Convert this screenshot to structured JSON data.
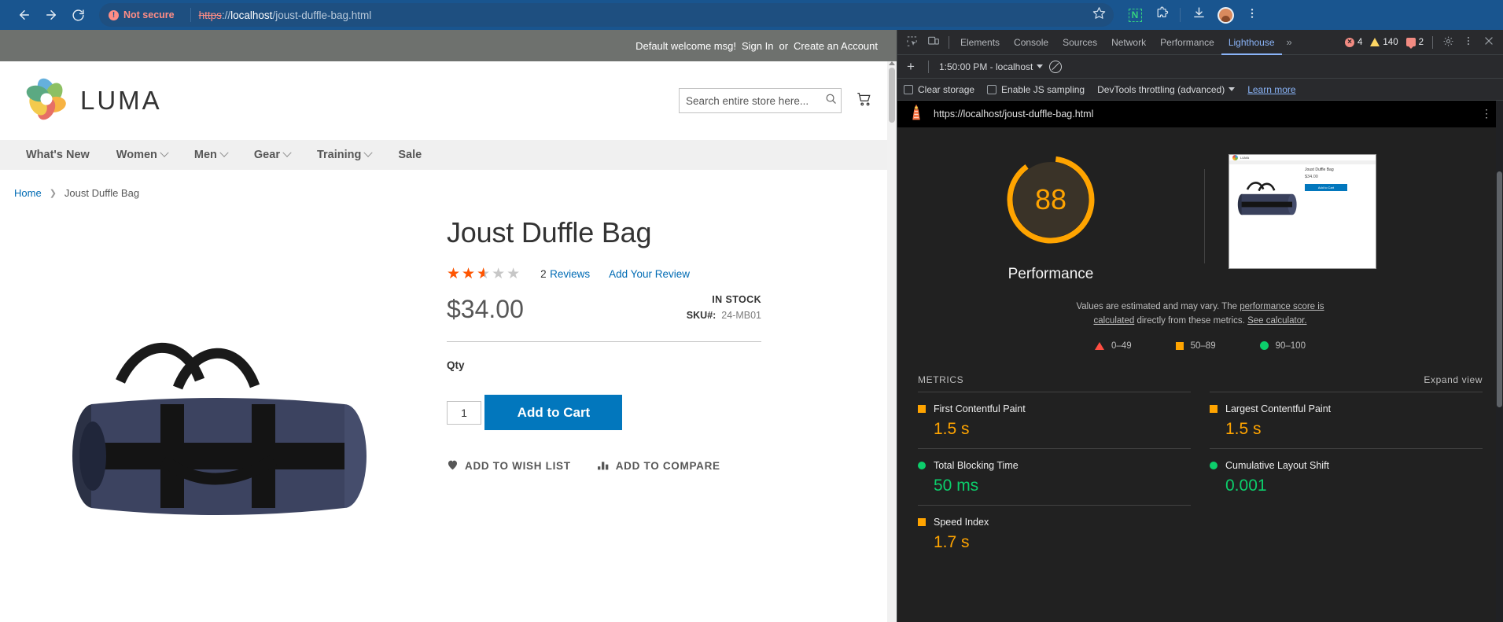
{
  "browser": {
    "back_icon": "back-arrow-icon",
    "forward_icon": "forward-arrow-icon",
    "reload_icon": "reload-icon",
    "security_label": "Not secure",
    "url_scheme": "https",
    "url_sep": "://",
    "url_host": "localhost",
    "url_path": "/joust-duffle-bag.html",
    "bookmark_icon": "star-icon",
    "extension_badge": "N",
    "extensions_icon": "puzzle-piece-icon",
    "downloads_icon": "download-icon",
    "profile_icon": "avatar-icon",
    "menu_icon": "three-dot-menu-icon"
  },
  "store": {
    "topbar": {
      "welcome": "Default welcome msg!",
      "sign_in": "Sign In",
      "or": "or",
      "create_account": "Create an Account"
    },
    "brand": "LUMA",
    "search": {
      "placeholder": "Search entire store here...",
      "value": "",
      "icon": "search-icon"
    },
    "cart_icon": "shopping-cart-icon",
    "nav": [
      {
        "label": "What's New",
        "has_chevron": false
      },
      {
        "label": "Women",
        "has_chevron": true
      },
      {
        "label": "Men",
        "has_chevron": true
      },
      {
        "label": "Gear",
        "has_chevron": true
      },
      {
        "label": "Training",
        "has_chevron": true
      },
      {
        "label": "Sale",
        "has_chevron": false
      }
    ],
    "breadcrumb": {
      "home": "Home",
      "separator": "❯",
      "current": "Joust Duffle Bag"
    },
    "product": {
      "title": "Joust Duffle Bag",
      "rating_percent": "50%",
      "stars_bg": "★★★★★",
      "review_count": "2",
      "reviews_label": "Reviews",
      "add_review": "Add Your Review",
      "price": "$34.00",
      "availability": "IN STOCK",
      "sku_label": "SKU#:",
      "sku_value": "24-MB01",
      "qty_label": "Qty",
      "qty_value": "1",
      "add_to_cart": "Add to Cart",
      "wish_list": "ADD TO WISH LIST",
      "wish_list_icon": "heart-icon",
      "compare": "ADD TO COMPARE",
      "compare_icon": "bar-chart-icon"
    }
  },
  "devtools": {
    "inspect_icon": "inspect-element-icon",
    "device_icon": "device-toolbar-icon",
    "tabs": [
      {
        "label": "Elements",
        "active": false
      },
      {
        "label": "Console",
        "active": false
      },
      {
        "label": "Sources",
        "active": false
      },
      {
        "label": "Network",
        "active": false
      },
      {
        "label": "Performance",
        "active": false
      },
      {
        "label": "Lighthouse",
        "active": true
      }
    ],
    "more_tabs": "»",
    "errors": "4",
    "warnings": "140",
    "violations": "2",
    "settings_icon": "gear-icon",
    "kebab_icon": "three-dot-menu-icon",
    "close_icon": "close-icon",
    "lighthouse_toolbar": {
      "new_report_icon": "plus-icon",
      "run_selector": "1:50:00 PM - localhost",
      "clear_icon": "clear-icon"
    },
    "lighthouse_settings": {
      "clear_storage": "Clear storage",
      "enable_js_sampling": "Enable JS sampling",
      "throttling": "DevTools throttling (advanced)",
      "learn_more": "Learn more"
    },
    "report": {
      "lighthouse_icon": "lighthouse-icon",
      "url": "https://localhost/joust-duffle-bag.html",
      "kebab_icon": "three-dot-menu-icon",
      "score": "88",
      "category": "Performance",
      "description_part1": "Values are estimated and may vary. The ",
      "description_link1": "performance score is calculated",
      "description_part2": " directly from these metrics. ",
      "description_link2": "See calculator.",
      "legend": [
        {
          "shape": "triangle",
          "range": "0–49",
          "color": "#ff4e42"
        },
        {
          "shape": "square",
          "range": "50–89",
          "color": "#ffa400"
        },
        {
          "shape": "circle",
          "range": "90–100",
          "color": "#0cce6b"
        }
      ],
      "metrics_heading": "METRICS",
      "expand_view": "Expand view",
      "metrics": [
        {
          "name": "First Contentful Paint",
          "value": "1.5 s",
          "status": "average"
        },
        {
          "name": "Largest Contentful Paint",
          "value": "1.5 s",
          "status": "average"
        },
        {
          "name": "Total Blocking Time",
          "value": "50 ms",
          "status": "good"
        },
        {
          "name": "Cumulative Layout Shift",
          "value": "0.001",
          "status": "good"
        },
        {
          "name": "Speed Index",
          "value": "1.7 s",
          "status": "average"
        }
      ],
      "thumbnail": {
        "brand": "LUMA",
        "title": "Joust Duffle Bag",
        "price": "$34.00",
        "button": "Add to Cart"
      }
    }
  },
  "colors": {
    "chrome_blue": "#19558f",
    "luma_blue": "#0277bd",
    "lh_orange": "#ffa400",
    "lh_green": "#0cce6b",
    "lh_red": "#ff4e42",
    "link_blue": "#006bb4"
  }
}
